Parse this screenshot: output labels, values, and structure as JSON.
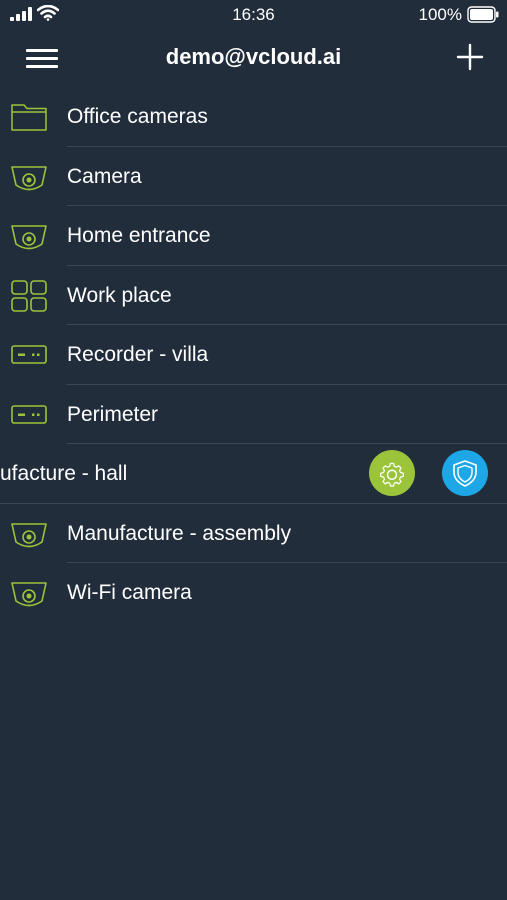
{
  "status_bar": {
    "time": "16:36",
    "battery": "100%"
  },
  "header": {
    "title": "demo@vcloud.ai"
  },
  "colors": {
    "background": "#222d3b",
    "icon_accent": "#9bc43a",
    "settings_action": "#9bc43a",
    "security_action": "#1ea7e6",
    "divider": "#3a4654"
  },
  "items": [
    {
      "label": "Office cameras",
      "icon": "folder-icon"
    },
    {
      "label": "Camera",
      "icon": "camera-icon"
    },
    {
      "label": "Home entrance",
      "icon": "camera-icon"
    },
    {
      "label": "Work place",
      "icon": "grid-icon"
    },
    {
      "label": "Recorder - villa",
      "icon": "recorder-icon"
    },
    {
      "label": "Perimeter",
      "icon": "recorder-icon"
    },
    {
      "label": "ufacture - hall",
      "icon": null,
      "actions": [
        "settings-icon",
        "shield-icon"
      ]
    },
    {
      "label": "Manufacture - assembly",
      "icon": "camera-icon"
    },
    {
      "label": "Wi-Fi camera",
      "icon": "camera-icon"
    }
  ]
}
